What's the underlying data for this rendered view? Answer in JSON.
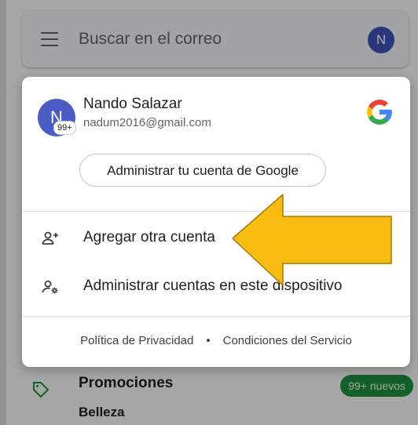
{
  "search": {
    "placeholder": "Buscar en el correo",
    "avatar_letter": "N"
  },
  "account": {
    "avatar_letter": "N",
    "badge": "99+",
    "name": "Nando Salazar",
    "email": "nadum2016@gmail.com",
    "manage_button": "Administrar tu cuenta de Google"
  },
  "menu": {
    "add_account": "Agregar otra cuenta",
    "manage_accounts": "Administrar cuentas en este dispositivo"
  },
  "footer": {
    "privacy": "Política de Privacidad",
    "separator": "•",
    "terms": "Condiciones del Servicio"
  },
  "background": {
    "category_title": "Promociones",
    "category_sub": "Belleza",
    "category_badge": "99+ nuevos"
  },
  "colors": {
    "arrow_fill": "#f9b800",
    "avatar": "#4b5cc4",
    "badge_green": "#1e8e3e"
  }
}
